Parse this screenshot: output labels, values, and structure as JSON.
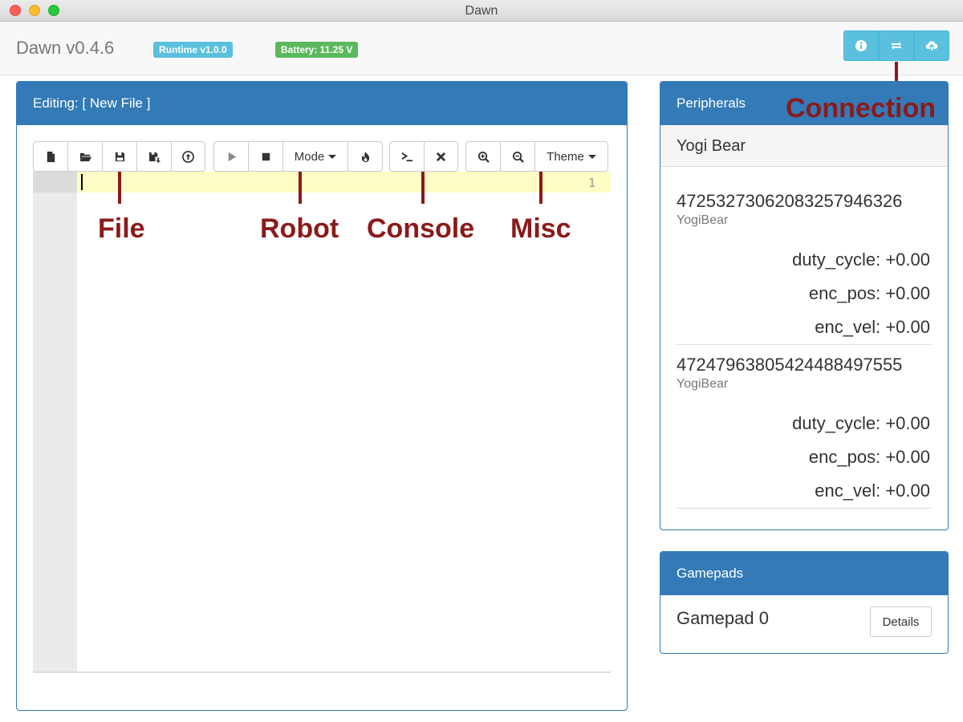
{
  "window": {
    "title": "Dawn"
  },
  "navbar": {
    "brand": "Dawn v0.4.6",
    "runtime_badge": "Runtime v1.0.0",
    "battery_badge": "Battery: 11.25 V",
    "connection_buttons": [
      {
        "icon": "info-icon"
      },
      {
        "icon": "exchange-icon"
      },
      {
        "icon": "cloud-upload-icon"
      }
    ]
  },
  "editor": {
    "heading": "Editing: [ New File ]",
    "line_numbers": [
      "1"
    ],
    "toolbar": {
      "file": [
        "new-file-icon",
        "open-folder-icon",
        "save-icon",
        "save-as-icon",
        "upload-icon"
      ],
      "robot": {
        "run_icon": "play-icon",
        "stop_icon": "stop-icon",
        "mode_label": "Mode",
        "estop_icon": "fire-icon"
      },
      "console": [
        "console-icon",
        "clear-icon"
      ],
      "misc": {
        "zoom_in_icon": "zoom-in-icon",
        "zoom_out_icon": "zoom-out-icon",
        "theme_label": "Theme"
      }
    }
  },
  "annotations": {
    "file": "File",
    "robot": "Robot",
    "console": "Console",
    "misc": "Misc",
    "connection": "Connection"
  },
  "peripherals": {
    "heading": "Peripherals",
    "group": "Yogi Bear",
    "devices": [
      {
        "id": "4725327306208325794632 6",
        "type": "YogiBear",
        "params": [
          "duty_cycle: +0.00",
          "enc_pos: +0.00",
          "enc_vel: +0.00"
        ]
      },
      {
        "id": "4724796380542448849755 5",
        "type": "YogiBear",
        "params": [
          "duty_cycle: +0.00",
          "enc_pos: +0.00",
          "enc_vel: +0.00"
        ]
      }
    ]
  },
  "gamepads": {
    "heading": "Gamepads",
    "items": [
      {
        "name": "Gamepad 0",
        "button": "Details"
      }
    ]
  },
  "colors": {
    "primary": "#337ab7",
    "info": "#5bc0de",
    "success": "#5cb85c",
    "annotation": "#8b1a1a"
  }
}
